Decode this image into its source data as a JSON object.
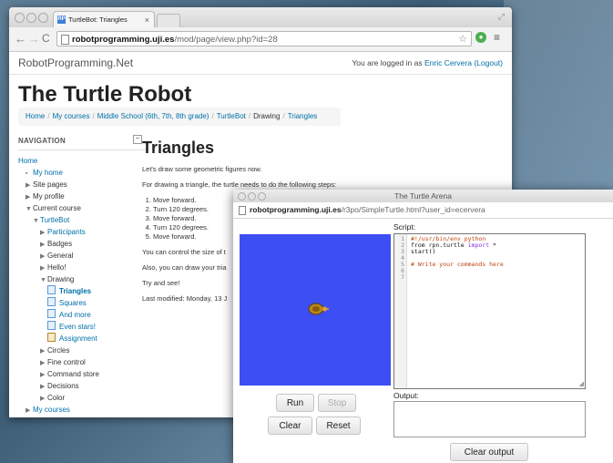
{
  "browser": {
    "tab_title": "TurtleBot: Triangles",
    "tab_favicon": "RP",
    "url_domain": "robotprogramming.uji.es",
    "url_path": "/mod/page/view.php?id=28"
  },
  "site": {
    "name": "RobotProgramming.Net",
    "login_prefix": "You are logged in as",
    "user_name": "Enric Cervera",
    "logout": "(Logout)"
  },
  "page": {
    "title": "The Turtle Robot",
    "breadcrumb": [
      "Home",
      "My courses",
      "Middle School (6th, 7th, 8th grade)",
      "TurtleBot",
      "Drawing",
      "Triangles"
    ]
  },
  "nav": {
    "heading": "NAVIGATION",
    "items": [
      {
        "label": "Home",
        "kind": "link",
        "indent": 0
      },
      {
        "label": "My home",
        "kind": "link",
        "indent": 1,
        "marker": "bullet"
      },
      {
        "label": "Site pages",
        "kind": "plain",
        "indent": 1,
        "marker": "closed"
      },
      {
        "label": "My profile",
        "kind": "plain",
        "indent": 1,
        "marker": "closed"
      },
      {
        "label": "Current course",
        "kind": "plain",
        "indent": 1,
        "marker": "open"
      },
      {
        "label": "TurtleBot",
        "kind": "link",
        "indent": 2,
        "marker": "open"
      },
      {
        "label": "Participants",
        "kind": "link",
        "indent": 3,
        "marker": "closed"
      },
      {
        "label": "Badges",
        "kind": "plain",
        "indent": 3,
        "marker": "closed"
      },
      {
        "label": "General",
        "kind": "plain",
        "indent": 3,
        "marker": "closed"
      },
      {
        "label": "Hello!",
        "kind": "plain",
        "indent": 3,
        "marker": "closed"
      },
      {
        "label": "Drawing",
        "kind": "plain",
        "indent": 3,
        "marker": "open"
      },
      {
        "label": "Triangles",
        "kind": "active",
        "indent": 4,
        "marker": "doc"
      },
      {
        "label": "Squares",
        "kind": "link",
        "indent": 4,
        "marker": "doc"
      },
      {
        "label": "And more",
        "kind": "link",
        "indent": 4,
        "marker": "doc"
      },
      {
        "label": "Even stars!",
        "kind": "link",
        "indent": 4,
        "marker": "doc"
      },
      {
        "label": "Assignment",
        "kind": "link",
        "indent": 4,
        "marker": "assign"
      },
      {
        "label": "Circles",
        "kind": "plain",
        "indent": 3,
        "marker": "closed"
      },
      {
        "label": "Fine control",
        "kind": "plain",
        "indent": 3,
        "marker": "closed"
      },
      {
        "label": "Command store",
        "kind": "plain",
        "indent": 3,
        "marker": "closed"
      },
      {
        "label": "Decisions",
        "kind": "plain",
        "indent": 3,
        "marker": "closed"
      },
      {
        "label": "Color",
        "kind": "plain",
        "indent": 3,
        "marker": "closed"
      },
      {
        "label": "My courses",
        "kind": "link",
        "indent": 1,
        "marker": "closed"
      }
    ]
  },
  "content": {
    "heading": "Triangles",
    "intro": "Let's draw some geometric figures now.",
    "steps_intro": "For drawing a triangle, the turtle needs to do the following steps:",
    "steps": [
      "Move forward.",
      "Turn 120 degrees.",
      "Move forward.",
      "Turn 120 degrees.",
      "Move forward."
    ],
    "para1": "You can control the size of t",
    "para2": "Also, you can draw your tria",
    "para3": "Try and see!",
    "modified": "Last modified: Monday, 13 J"
  },
  "arena": {
    "title": "The Turtle Arena",
    "url_domain": "robotprogramming.uji.es",
    "url_path": "/r3po/SimpleTurtle.html?user_id=ecervera",
    "script_label": "Script:",
    "line_numbers": "1\n2\n3\n4\n5\n6\n7",
    "code": {
      "l1": "#!/usr/bin/env python",
      "l2_a": "from rpn.turtle ",
      "l2_kw": "import",
      "l2_b": " *",
      "l3": "start()",
      "l5": "# Write your commands here"
    },
    "buttons": {
      "run": "Run",
      "stop": "Stop",
      "clear": "Clear",
      "reset": "Reset",
      "clear_output": "Clear output"
    },
    "output_label": "Output:",
    "canvas_color": "#3d4ef3"
  }
}
